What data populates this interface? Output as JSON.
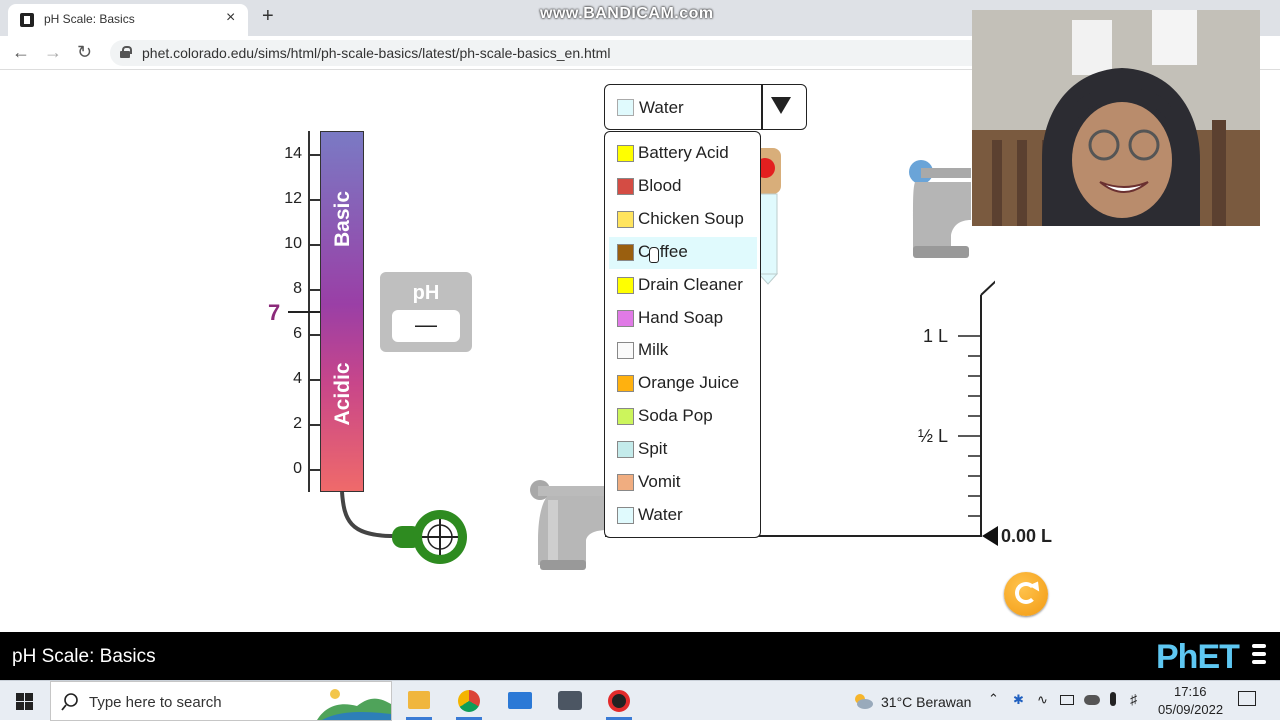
{
  "browser": {
    "tab_title": "pH Scale: Basics",
    "tab_close": "×",
    "new_tab": "+",
    "url": "phet.colorado.edu/sims/html/ph-scale-basics/latest/ph-scale-basics_en.html",
    "watermark": "www.BANDICAM.com"
  },
  "meter": {
    "scale_ticks": [
      "14",
      "12",
      "10",
      "8",
      "6",
      "4",
      "2",
      "0"
    ],
    "neutral_marker": "7",
    "basic_label": "Basic",
    "acidic_label": "Acidic",
    "ph_label": "pH",
    "ph_value": "—"
  },
  "solute_combo": {
    "selected": "Water",
    "selected_color": "#e0fafd",
    "items": [
      {
        "label": "Battery Acid",
        "color": "#ffff00"
      },
      {
        "label": "Blood",
        "color": "#d44c44"
      },
      {
        "label": "Chicken Soup",
        "color": "#ffe45e"
      },
      {
        "label": "Coffee",
        "color": "#9a5f0f"
      },
      {
        "label": "Drain Cleaner",
        "color": "#ffff00"
      },
      {
        "label": "Hand Soap",
        "color": "#e07ae6"
      },
      {
        "label": "Milk",
        "color": "#fafafa"
      },
      {
        "label": "Orange Juice",
        "color": "#ffb10f"
      },
      {
        "label": "Soda Pop",
        "color": "#ccf55c"
      },
      {
        "label": "Spit",
        "color": "#c4ebeb"
      },
      {
        "label": "Vomit",
        "color": "#f0ad80"
      },
      {
        "label": "Water",
        "color": "#e0fafd"
      }
    ],
    "hovered_index": 3
  },
  "beaker": {
    "label_1l": "1 L",
    "label_half": "½ L",
    "volume": "0.00 L"
  },
  "sim": {
    "title": "pH Scale: Basics",
    "logo": "PhET"
  },
  "taskbar": {
    "search_placeholder": "Type here to search",
    "weather": "31°C  Berawan",
    "time": "17:16",
    "date": "05/09/2022"
  }
}
